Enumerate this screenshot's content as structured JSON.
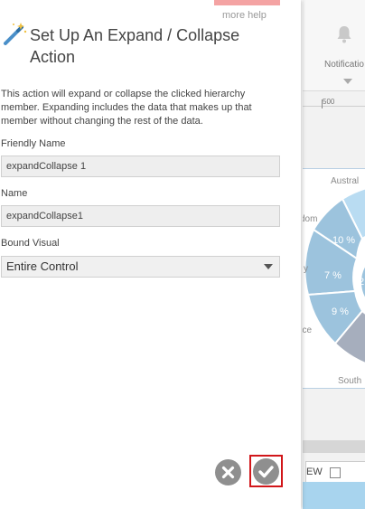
{
  "dialog": {
    "more_help": "more help",
    "title": "Set Up An Expand / Collapse Action",
    "description": "This action will expand or collapse the clicked hierarchy member. Expanding includes the data that makes up that member without changing the rest of the data.",
    "fields": {
      "friendly_name_label": "Friendly Name",
      "friendly_name_value": "expandCollapse 1",
      "name_label": "Name",
      "name_value": "expandCollapse1",
      "bound_visual_label": "Bound Visual",
      "bound_visual_value": "Entire Control"
    },
    "buttons": {
      "cancel_icon": "x-circle-icon",
      "ok_icon": "checkmark-circle-icon"
    }
  },
  "background": {
    "notifications_label": "Notificatio",
    "ruler_tick": "500",
    "chart_labels": {
      "top": "Austral",
      "left1": "dom",
      "left2": "y",
      "left3": "nce",
      "bottom": "South"
    },
    "chart_values": [
      "10 %",
      "7 %",
      "9 %",
      "2"
    ],
    "view_button": "EW"
  },
  "colors": {
    "highlight": "#d1161a",
    "help_bar": "#f4a3a3",
    "pie_blue": "#9cc3dd",
    "pie_light": "#b9dcf2",
    "pie_gray": "#a6aebd"
  }
}
